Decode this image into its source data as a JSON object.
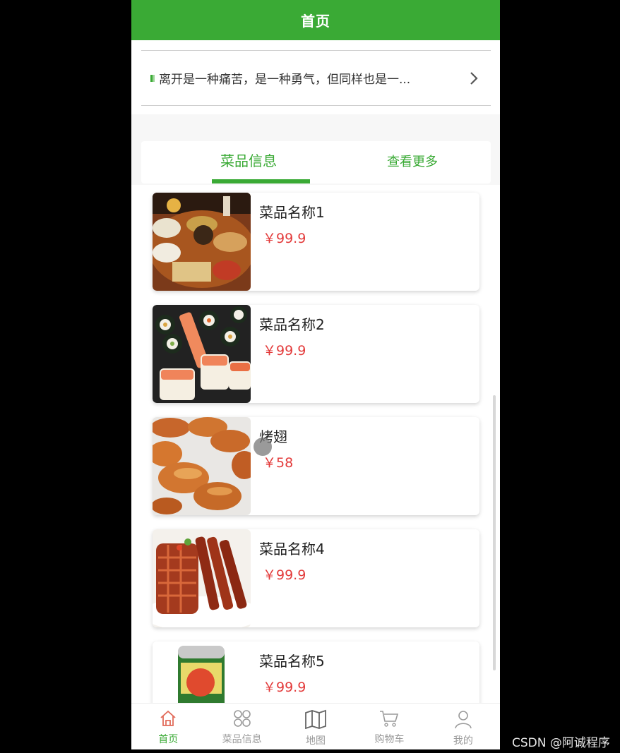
{
  "header": {
    "title": "首页"
  },
  "notice": {
    "text": "离开是一种痛苦，是一种勇气，但同样也是一..."
  },
  "section_tabs": {
    "active": "菜品信息",
    "more": "查看更多"
  },
  "dishes": [
    {
      "name": "菜品名称1",
      "price": "￥99.9",
      "image": "banquet-dishes"
    },
    {
      "name": "菜品名称2",
      "price": "￥99.9",
      "image": "sushi-rolls"
    },
    {
      "name": "烤翅",
      "price": "￥58",
      "image": "roasted-wings"
    },
    {
      "name": "菜品名称4",
      "price": "￥99.9",
      "image": "braised-meat"
    },
    {
      "name": "菜品名称5",
      "price": "￥99.9",
      "image": "soda-can"
    }
  ],
  "bottom_nav": [
    {
      "label": "首页",
      "icon": "home-icon",
      "active": true
    },
    {
      "label": "菜品信息",
      "icon": "grid-icon",
      "active": false
    },
    {
      "label": "地图",
      "icon": "map-icon",
      "active": false
    },
    {
      "label": "购物车",
      "icon": "cart-icon",
      "active": false
    },
    {
      "label": "我的",
      "icon": "user-icon",
      "active": false
    }
  ],
  "watermark": "CSDN @阿诚程序",
  "colors": {
    "brand_green": "#3aaa35",
    "price_red": "#e33b3b"
  }
}
